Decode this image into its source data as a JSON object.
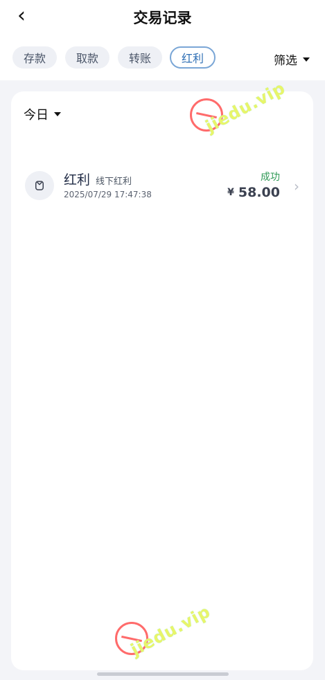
{
  "header": {
    "title": "交易记录",
    "back_icon": "chevron-left-icon"
  },
  "tabs": [
    {
      "label": "存款"
    },
    {
      "label": "取款"
    },
    {
      "label": "转账"
    },
    {
      "label": "红利",
      "active": true
    }
  ],
  "filter": {
    "label": "筛选"
  },
  "list": {
    "date_range": "今日",
    "items": [
      {
        "title": "红利",
        "subtitle": "线下红利",
        "datetime": "2025/07/29 17:47:38",
        "status": "成功",
        "currency": "¥",
        "amount": "58.00"
      }
    ]
  },
  "watermark": {
    "text": "jiedu.vip"
  },
  "colors": {
    "accent": "#7aa6d6",
    "success": "#2f9a56",
    "background": "#f3f4f8"
  }
}
